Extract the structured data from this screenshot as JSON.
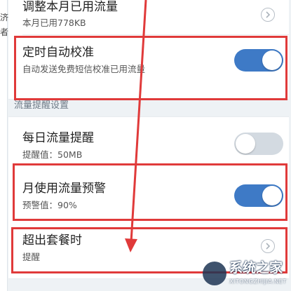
{
  "left_fragment": {
    "chars": [
      "济",
      "者"
    ]
  },
  "usage_adjust": {
    "title": "调整本月已用流量",
    "subtitle": "本月已用778KB"
  },
  "auto_calibrate": {
    "title": "定时自动校准",
    "subtitle": "自动发送免费短信校准已用流量",
    "enabled": true
  },
  "section": {
    "label": "流量提醒设置"
  },
  "daily_reminder": {
    "title": "每日流量提醒",
    "subtitle": "提醒值：50MB",
    "enabled": false
  },
  "monthly_warning": {
    "title": "月使用流量预警",
    "subtitle": "预警值：90%",
    "enabled": true
  },
  "overage": {
    "title": "超出套餐时",
    "subtitle": "提醒"
  },
  "watermark": {
    "name": "系统之家",
    "url": "XITONGZHIJIA.NET"
  },
  "colors": {
    "toggle_on": "#3e7ac6",
    "toggle_off": "#d3dae1",
    "highlight": "#e03a3a",
    "background": "#eef2f5"
  }
}
